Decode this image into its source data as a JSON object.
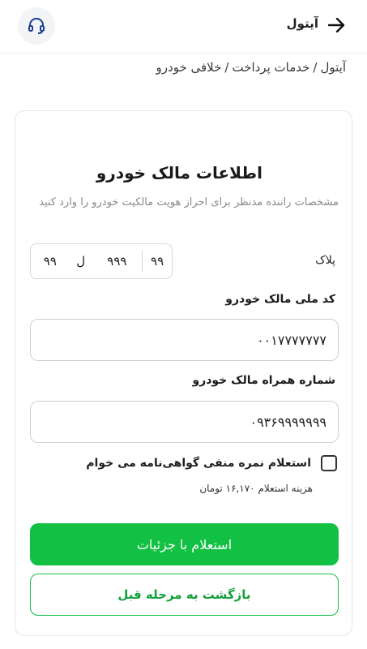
{
  "header": {
    "title": "آیتول",
    "back_icon": "arrow-right-icon",
    "support_icon": "headset-icon"
  },
  "breadcrumb": {
    "items": [
      "آیتول",
      "خدمات پرداخت",
      "خلافی خودرو"
    ],
    "separator": "/"
  },
  "card": {
    "title": "اطلاعات مالک خودرو",
    "description": "مشخصات راننده مدنظر برای احراز هویت مالکیت خودرو را وارد کنید",
    "plate": {
      "label": "پلاک",
      "part_two_digits": "۹۹",
      "part_three_digits": "۹۹۹",
      "letter": "ل",
      "region": "۹۹"
    },
    "national_id": {
      "label": "کد ملی مالک خودرو",
      "value": "۰۰۱۷۷۷۷۷۷۷"
    },
    "mobile": {
      "label": "شماره همراه مالک خودرو",
      "value": "۰۹۳۶۹۹۹۹۹۹۹"
    },
    "negative_points": {
      "label": "استعلام نمره منفی گواهی‌نامه می خوام",
      "checked": false,
      "cost_note": "هزینه استعلام ۱۶,۱۷۰ تومان"
    },
    "submit_label": "استعلام با جزئیات",
    "back_label": "بازگشت به مرحله قبل"
  },
  "colors": {
    "primary": "#12c043",
    "border": "#cfcfcf",
    "muted_text": "#8a8a8a"
  }
}
